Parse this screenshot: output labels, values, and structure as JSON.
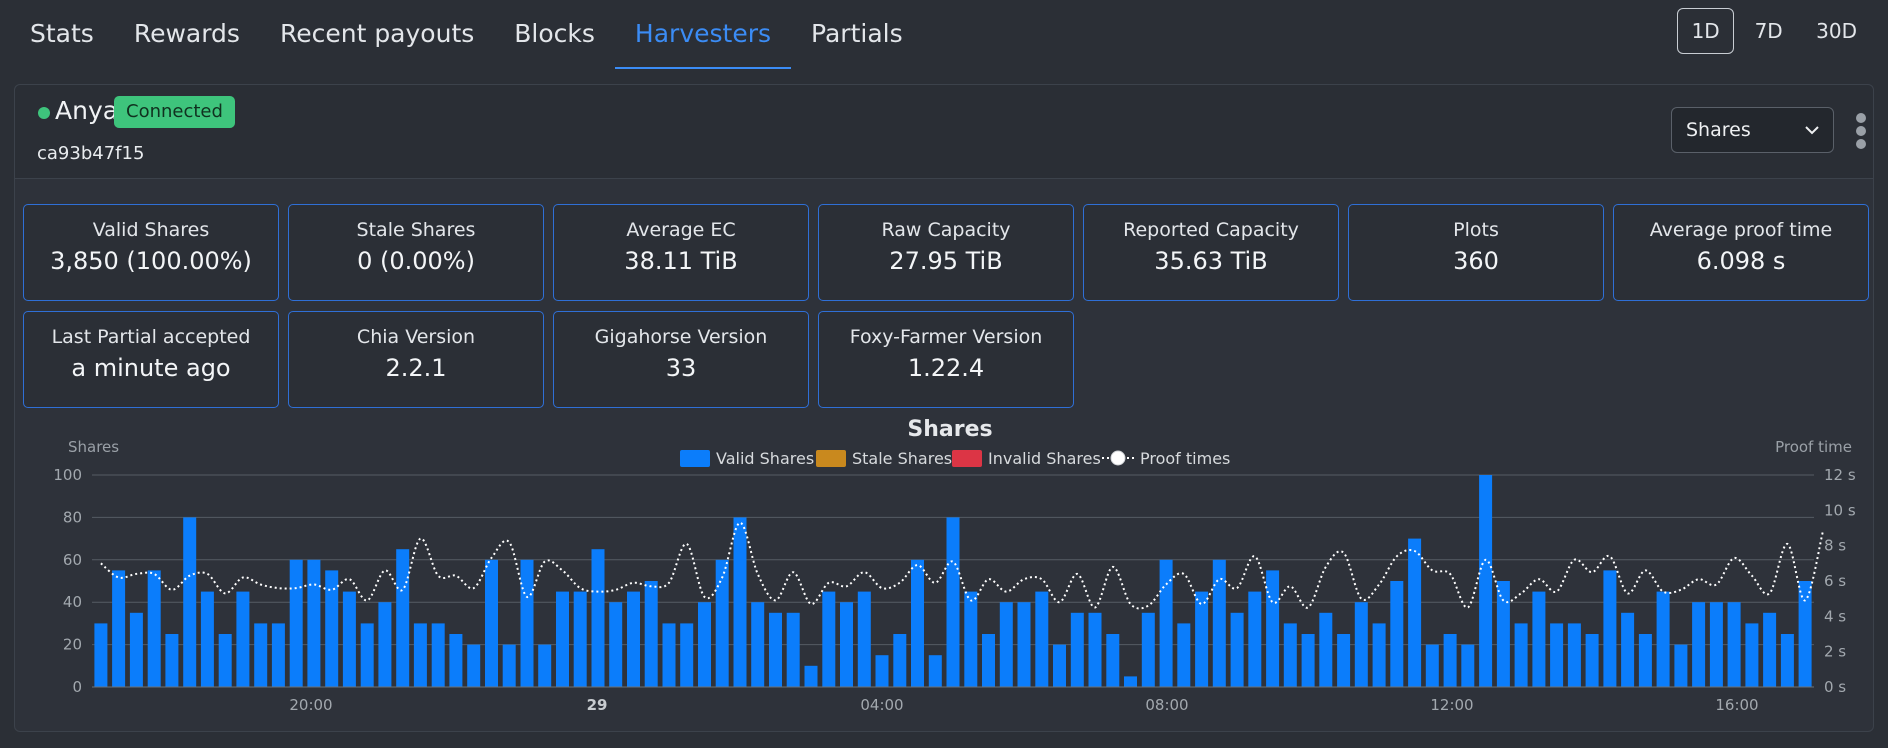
{
  "nav": {
    "tabs": [
      "Stats",
      "Rewards",
      "Recent payouts",
      "Blocks",
      "Harvesters",
      "Partials"
    ],
    "active_tab": "Harvesters",
    "ranges": [
      "1D",
      "7D",
      "30D"
    ],
    "active_range": "1D"
  },
  "harvester": {
    "name": "Anya",
    "status": "Connected",
    "status_color": "#3ec47c",
    "id": "ca93b47f15",
    "view_select": "Shares"
  },
  "stats": [
    {
      "label": "Valid Shares",
      "value": "3,850 (100.00%)"
    },
    {
      "label": "Stale Shares",
      "value": "0 (0.00%)"
    },
    {
      "label": "Average EC",
      "value": "38.11 TiB"
    },
    {
      "label": "Raw Capacity",
      "value": "27.95 TiB"
    },
    {
      "label": "Reported Capacity",
      "value": "35.63 TiB"
    },
    {
      "label": "Plots",
      "value": "360"
    },
    {
      "label": "Average proof time",
      "value": "6.098 s"
    },
    {
      "label": "Last Partial accepted",
      "value": "a minute ago"
    },
    {
      "label": "Chia Version",
      "value": "2.2.1"
    },
    {
      "label": "Gigahorse Version",
      "value": "33"
    },
    {
      "label": "Foxy-Farmer Version",
      "value": "1.22.4"
    }
  ],
  "colors": {
    "accent": "#3b8cf5",
    "valid": "#0b7dfb",
    "stale": "#c9891e",
    "invalid": "#dc3545",
    "proof": "#ffffff"
  },
  "chart_data": {
    "type": "bar",
    "title": "Shares",
    "ylabel": "Shares",
    "y2label": "Proof time",
    "ylim": [
      0,
      100
    ],
    "y2lim": [
      0,
      12
    ],
    "yticks": [
      "0",
      "20",
      "40",
      "60",
      "80",
      "100"
    ],
    "y2ticks": [
      "0 s",
      "2 s",
      "4 s",
      "6 s",
      "8 s",
      "10 s",
      "12 s"
    ],
    "xticks": [
      "20:00",
      "29",
      "04:00",
      "08:00",
      "12:00",
      "16:00"
    ],
    "legend": [
      "Valid Shares",
      "Stale Shares",
      "Invalid Shares",
      "Proof times"
    ],
    "legend_position": "top",
    "series": [
      {
        "name": "Valid Shares",
        "values": [
          30,
          55,
          35,
          55,
          25,
          80,
          45,
          25,
          45,
          30,
          30,
          60,
          60,
          55,
          45,
          30,
          40,
          65,
          30,
          30,
          25,
          20,
          60,
          20,
          60,
          20,
          45,
          45,
          65,
          40,
          45,
          50,
          30,
          30,
          40,
          60,
          80,
          40,
          35,
          35,
          10,
          45,
          40,
          45,
          15,
          25,
          60,
          15,
          80,
          45,
          25,
          40,
          40,
          45,
          20,
          35,
          35,
          25,
          5,
          35,
          60,
          30,
          45,
          60,
          35,
          45,
          55,
          30,
          25,
          35,
          25,
          40,
          30,
          50,
          70,
          20,
          25,
          20,
          100,
          50,
          30,
          45,
          30,
          30,
          25,
          55,
          35,
          25,
          45,
          20,
          40,
          40,
          40,
          30,
          35,
          25,
          50
        ]
      },
      {
        "name": "Stale Shares",
        "values": [
          0,
          0,
          0,
          0,
          0,
          0,
          0,
          0,
          0,
          0,
          0,
          0,
          0,
          0,
          0,
          0,
          0,
          0,
          0,
          0,
          0,
          0,
          0,
          0,
          0,
          0,
          0,
          0,
          0,
          0,
          0,
          0,
          0,
          0,
          0,
          0,
          0,
          0,
          0,
          0,
          0,
          0,
          0,
          0,
          0,
          0,
          0,
          0,
          0,
          0,
          0,
          0,
          0,
          0,
          0,
          0,
          0,
          0,
          0,
          0,
          0,
          0,
          0,
          0,
          0,
          0,
          0,
          0,
          0,
          0,
          0,
          0,
          0,
          0,
          0,
          0,
          0,
          0,
          0,
          0,
          0,
          0,
          0,
          0,
          0,
          0,
          0,
          0,
          0,
          0,
          0,
          0,
          0,
          0,
          0,
          0,
          0
        ]
      },
      {
        "name": "Invalid Shares",
        "values": [
          0,
          0,
          0,
          0,
          0,
          0,
          0,
          0,
          0,
          0,
          0,
          0,
          0,
          0,
          0,
          0,
          0,
          0,
          0,
          0,
          0,
          0,
          0,
          0,
          0,
          0,
          0,
          0,
          0,
          0,
          0,
          0,
          0,
          0,
          0,
          0,
          0,
          0,
          0,
          0,
          0,
          0,
          0,
          0,
          0,
          0,
          0,
          0,
          0,
          0,
          0,
          0,
          0,
          0,
          0,
          0,
          0,
          0,
          0,
          0,
          0,
          0,
          0,
          0,
          0,
          0,
          0,
          0,
          0,
          0,
          0,
          0,
          0,
          0,
          0,
          0,
          0,
          0,
          0,
          0,
          0,
          0,
          0,
          0,
          0,
          0,
          0,
          0,
          0,
          0,
          0,
          0,
          0,
          0,
          0,
          0,
          0
        ]
      },
      {
        "name": "Proof times",
        "values": [
          7,
          6.2,
          6.4,
          6.4,
          5.5,
          6.3,
          6.4,
          5.3,
          6.2,
          5.8,
          5.6,
          5.6,
          5.8,
          5.5,
          6.1,
          4.9,
          6.6,
          5.5,
          8.4,
          6.3,
          6.3,
          5.6,
          7.3,
          8.2,
          5.1,
          7.1,
          6.6,
          5.6,
          5.4,
          5.5,
          5.9,
          5.7,
          5.9,
          8.1,
          5.1,
          6.2,
          9.3,
          6.4,
          4.9,
          6.5,
          4.7,
          5.9,
          5.7,
          6.5,
          5.6,
          5.9,
          6.9,
          5.9,
          7.1,
          4.9,
          6.1,
          5.4,
          6.1,
          6.1,
          4.8,
          6.4,
          4.5,
          6.8,
          4.7,
          4.6,
          5.8,
          6.4,
          4.7,
          6.1,
          5.6,
          7.4,
          4.8,
          5.7,
          4.5,
          6.8,
          7.6,
          5,
          5.8,
          7.4,
          7.7,
          6.6,
          6.4,
          4.5,
          7.2,
          4.9,
          5.3,
          6.1,
          5.4,
          7.2,
          6.5,
          7.4,
          5.3,
          6.6,
          5.4,
          5.5,
          6.1,
          5.8,
          7.3,
          6.3,
          5.3,
          8.1,
          4.9,
          8.8
        ]
      }
    ]
  }
}
